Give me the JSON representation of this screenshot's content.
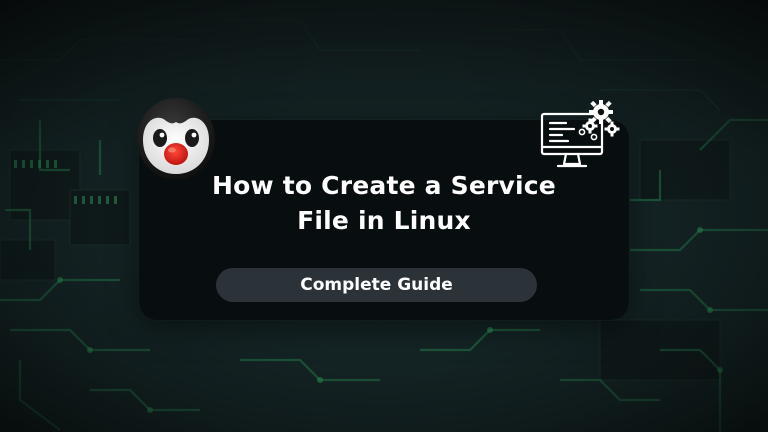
{
  "title": {
    "line1": "How to Create a Service",
    "line2": "File in Linux"
  },
  "subtitle": "Complete Guide",
  "icons": {
    "mascot": "penguin-icon",
    "computer": "monitor-gears-icon"
  },
  "colors": {
    "background": "#142022",
    "circuit": "#2fbf6a",
    "card": "#070b0d",
    "pill": "#2b3339",
    "text": "#ffffff",
    "penguin_beak": "#e8231f"
  }
}
